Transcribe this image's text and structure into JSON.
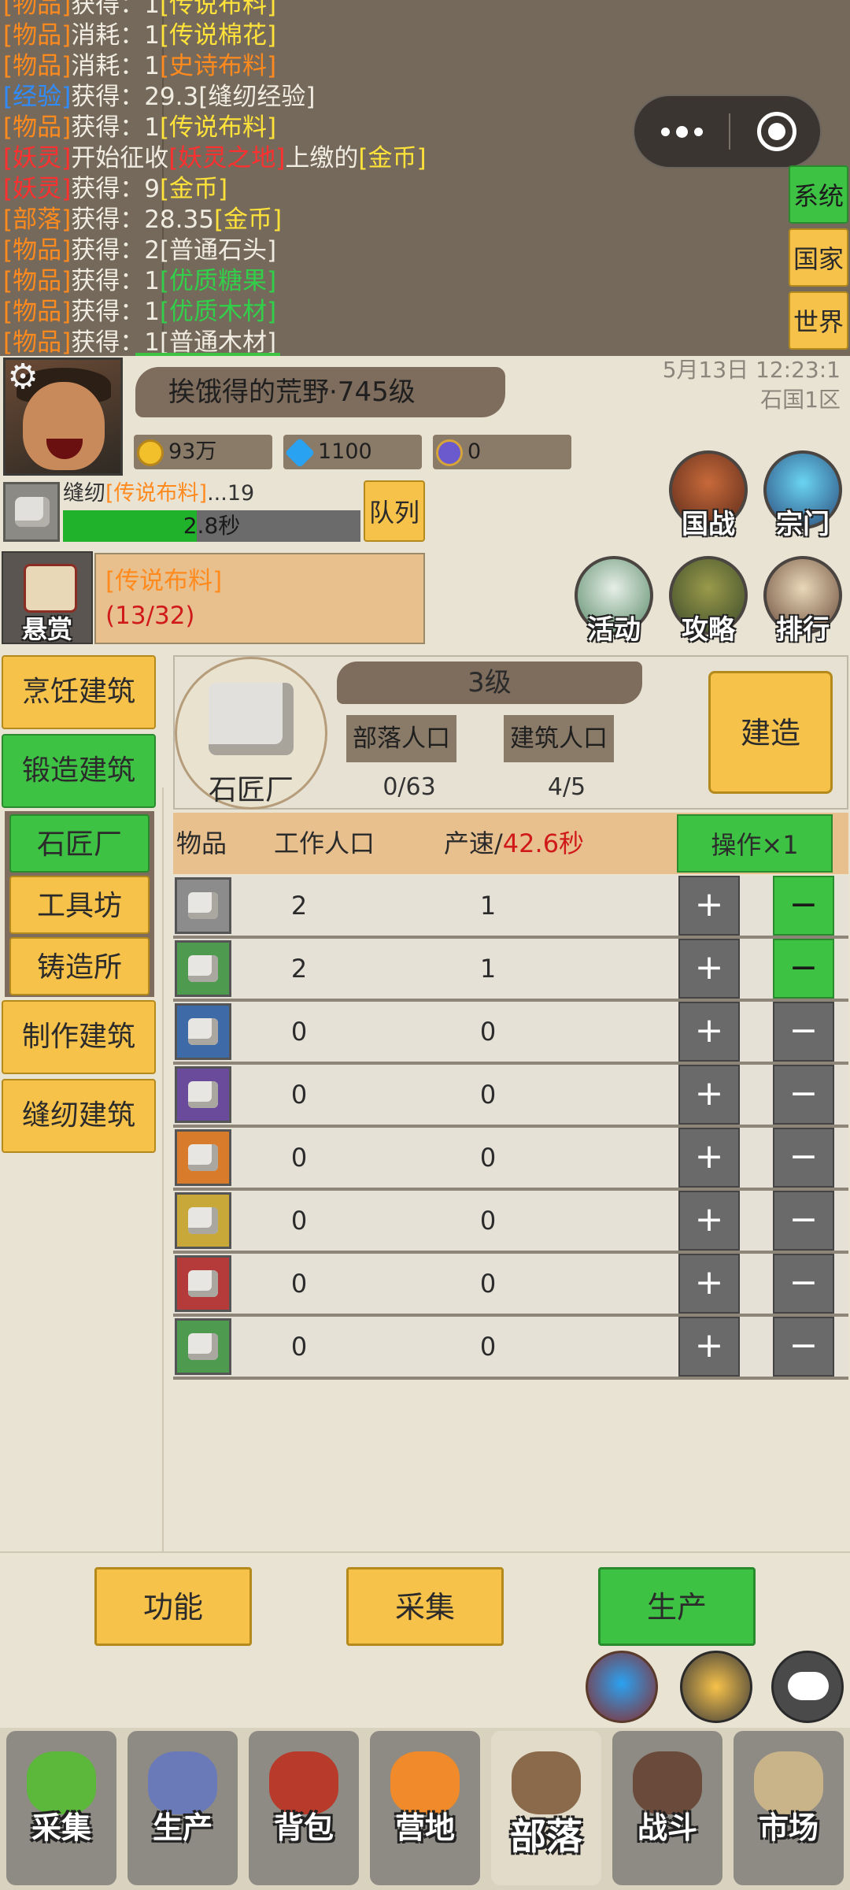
{
  "log": [
    {
      "cat": "[物品]",
      "catColor": "c-orange",
      "action": "获得：",
      "qty": "1",
      "item": "[传说布料]",
      "itemColor": "c-yellow",
      "tail": ""
    },
    {
      "cat": "[物品]",
      "catColor": "c-orange",
      "action": "消耗：",
      "qty": "1",
      "item": "[传说棉花]",
      "itemColor": "c-yellow",
      "tail": ""
    },
    {
      "cat": "[物品]",
      "catColor": "c-orange",
      "action": "消耗：",
      "qty": "1",
      "item": "[史诗布料]",
      "itemColor": "c-orange",
      "tail": ""
    },
    {
      "cat": "[经验]",
      "catColor": "c-blue",
      "action": "获得：",
      "qty": "29.3",
      "item": "[缝纫经验]",
      "itemColor": "c-white",
      "tail": ""
    },
    {
      "cat": "[物品]",
      "catColor": "c-orange",
      "action": "获得：",
      "qty": "1",
      "item": "[传说布料]",
      "itemColor": "c-yellow",
      "tail": ""
    },
    {
      "cat": "[妖灵]",
      "catColor": "c-red",
      "action": "开始征收",
      "qty": "",
      "item": "[妖灵之地]",
      "itemColor": "c-red",
      "tail": "上缴的",
      "tail2": "[金币]",
      "tail2Color": "c-yellow"
    },
    {
      "cat": "[妖灵]",
      "catColor": "c-red",
      "action": "获得：",
      "qty": "9",
      "item": "[金币]",
      "itemColor": "c-yellow",
      "tail": ""
    },
    {
      "cat": "[部落]",
      "catColor": "c-orange",
      "action": "获得：",
      "qty": "28.35",
      "item": "[金币]",
      "itemColor": "c-yellow",
      "tail": ""
    },
    {
      "cat": "[物品]",
      "catColor": "c-orange",
      "action": "获得：",
      "qty": "2",
      "item": "[普通石头]",
      "itemColor": "c-white",
      "tail": ""
    },
    {
      "cat": "[物品]",
      "catColor": "c-orange",
      "action": "获得：",
      "qty": "1",
      "item": "[优质糖果]",
      "itemColor": "c-green",
      "tail": ""
    },
    {
      "cat": "[物品]",
      "catColor": "c-orange",
      "action": "获得：",
      "qty": "1",
      "item": "[优质木材]",
      "itemColor": "c-green",
      "tail": ""
    },
    {
      "cat": "[物品]",
      "catColor": "c-orange",
      "action": "获得：",
      "qty": "1",
      "item": "[普通木材]",
      "itemColor": "c-white",
      "tail": ""
    }
  ],
  "channels": {
    "system": "系统",
    "country": "国家",
    "world": "世界"
  },
  "player": {
    "name": "挨饿得的荒野·745级",
    "date": "5月13日 12:23:1",
    "server": "石国1区",
    "gold": "93万",
    "diamond": "1100",
    "bag": "0"
  },
  "task": {
    "label": "缝纫",
    "item": "[传说布料]",
    "suffix": "...19",
    "time": "2.8秒",
    "progress": 0.45,
    "queue": "队列"
  },
  "shortcuts": {
    "war": "国战",
    "sect": "宗门",
    "event": "活动",
    "guide": "攻略",
    "rank": "排行"
  },
  "bounty": {
    "label": "悬赏",
    "item": "[传说布料]",
    "count": "(13/32)"
  },
  "categories": {
    "cooking": "烹饪建筑",
    "forging": "锻造建筑",
    "crafting": "制作建筑",
    "sewing": "缝纫建筑"
  },
  "sub_buildings": {
    "mason": "石匠厂",
    "tools": "工具坊",
    "foundry": "铸造所"
  },
  "building": {
    "name": "石匠厂",
    "level": "3级",
    "tribe_pop_label": "部落人口",
    "tribe_pop": "0/63",
    "bld_pop_label": "建筑人口",
    "bld_pop": "4/5",
    "build_label": "建造"
  },
  "table": {
    "col_item": "物品",
    "col_workers": "工作人口",
    "col_rate": "产速/",
    "rate_time": "42.6秒",
    "op_label": "操作×1",
    "plus": "+",
    "minus": "−",
    "rows": [
      {
        "workers": "2",
        "rate": "1",
        "tier": "#8c8c8c",
        "minusActive": true
      },
      {
        "workers": "2",
        "rate": "1",
        "tier": "#4e9a4e",
        "minusActive": true
      },
      {
        "workers": "0",
        "rate": "0",
        "tier": "#3f6aa8",
        "minusActive": false
      },
      {
        "workers": "0",
        "rate": "0",
        "tier": "#6a4a9a",
        "minusActive": false
      },
      {
        "workers": "0",
        "rate": "0",
        "tier": "#d87b2a",
        "minusActive": false
      },
      {
        "workers": "0",
        "rate": "0",
        "tier": "#c9a83a",
        "minusActive": false
      },
      {
        "workers": "0",
        "rate": "0",
        "tier": "#b53a3a",
        "minusActive": false
      },
      {
        "workers": "0",
        "rate": "0",
        "tier": "#4e9a4e",
        "minusActive": false
      }
    ]
  },
  "actions": {
    "function": "功能",
    "gather": "采集",
    "produce": "生产"
  },
  "nav": {
    "gather": "采集",
    "produce": "生产",
    "bag": "背包",
    "camp": "营地",
    "tribe": "部落",
    "battle": "战斗",
    "market": "市场"
  }
}
